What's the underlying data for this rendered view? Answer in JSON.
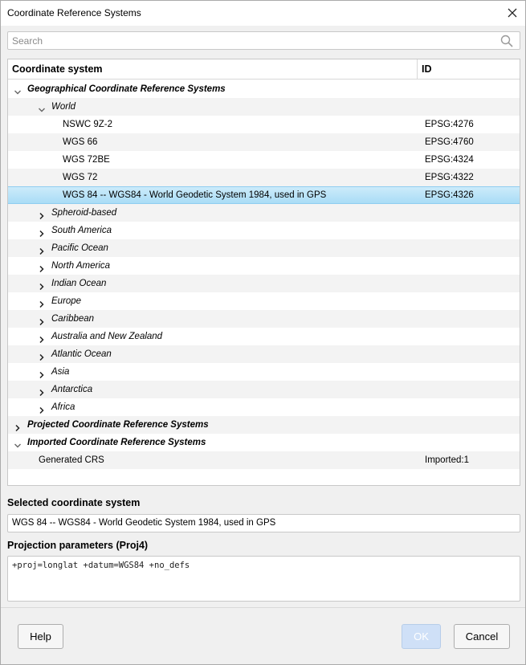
{
  "window": {
    "title": "Coordinate Reference Systems"
  },
  "search": {
    "placeholder": "Search",
    "value": ""
  },
  "tree": {
    "columns": {
      "name": "Coordinate system",
      "id": "ID"
    },
    "rows": [
      {
        "label": "Geographical Coordinate Reference Systems",
        "id": "",
        "level": 0,
        "expanded": true
      },
      {
        "label": "World",
        "id": "",
        "level": 1,
        "expanded": true
      },
      {
        "label": "NSWC 9Z-2",
        "id": "EPSG:4276",
        "level": 2
      },
      {
        "label": "WGS 66",
        "id": "EPSG:4760",
        "level": 2
      },
      {
        "label": "WGS 72BE",
        "id": "EPSG:4324",
        "level": 2
      },
      {
        "label": "WGS 72",
        "id": "EPSG:4322",
        "level": 2
      },
      {
        "label": "WGS 84 -- WGS84 - World Geodetic System 1984, used in GPS",
        "id": "EPSG:4326",
        "level": 2,
        "selected": true
      },
      {
        "label": "Spheroid-based",
        "id": "",
        "level": 1,
        "expanded": false
      },
      {
        "label": "South America",
        "id": "",
        "level": 1,
        "expanded": false
      },
      {
        "label": "Pacific Ocean",
        "id": "",
        "level": 1,
        "expanded": false
      },
      {
        "label": "North America",
        "id": "",
        "level": 1,
        "expanded": false
      },
      {
        "label": "Indian Ocean",
        "id": "",
        "level": 1,
        "expanded": false
      },
      {
        "label": "Europe",
        "id": "",
        "level": 1,
        "expanded": false
      },
      {
        "label": "Caribbean",
        "id": "",
        "level": 1,
        "expanded": false
      },
      {
        "label": "Australia and New Zealand",
        "id": "",
        "level": 1,
        "expanded": false
      },
      {
        "label": "Atlantic Ocean",
        "id": "",
        "level": 1,
        "expanded": false
      },
      {
        "label": "Asia",
        "id": "",
        "level": 1,
        "expanded": false
      },
      {
        "label": "Antarctica",
        "id": "",
        "level": 1,
        "expanded": false
      },
      {
        "label": "Africa",
        "id": "",
        "level": 1,
        "expanded": false
      },
      {
        "label": "Projected Coordinate Reference Systems",
        "id": "",
        "level": 0,
        "expanded": false
      },
      {
        "label": "Imported Coordinate Reference Systems",
        "id": "",
        "level": 0,
        "expanded": true
      },
      {
        "label": "Generated CRS",
        "id": "Imported:1",
        "level": 1,
        "leaf": true
      }
    ]
  },
  "selected_crs": {
    "label": "Selected coordinate system",
    "value": "WGS 84 -- WGS84 - World Geodetic System 1984, used in GPS"
  },
  "projection": {
    "label": "Projection parameters (Proj4)",
    "value": "+proj=longlat +datum=WGS84 +no_defs"
  },
  "buttons": {
    "help": "Help",
    "ok": "OK",
    "cancel": "Cancel"
  },
  "icons": {
    "close": "close-icon",
    "search": "search-icon",
    "expanded": "chevron-down-icon",
    "collapsed": "chevron-right-icon"
  },
  "colors": {
    "selected_row": "#a9dcf6",
    "ok_disabled": "#cfe0f7"
  }
}
